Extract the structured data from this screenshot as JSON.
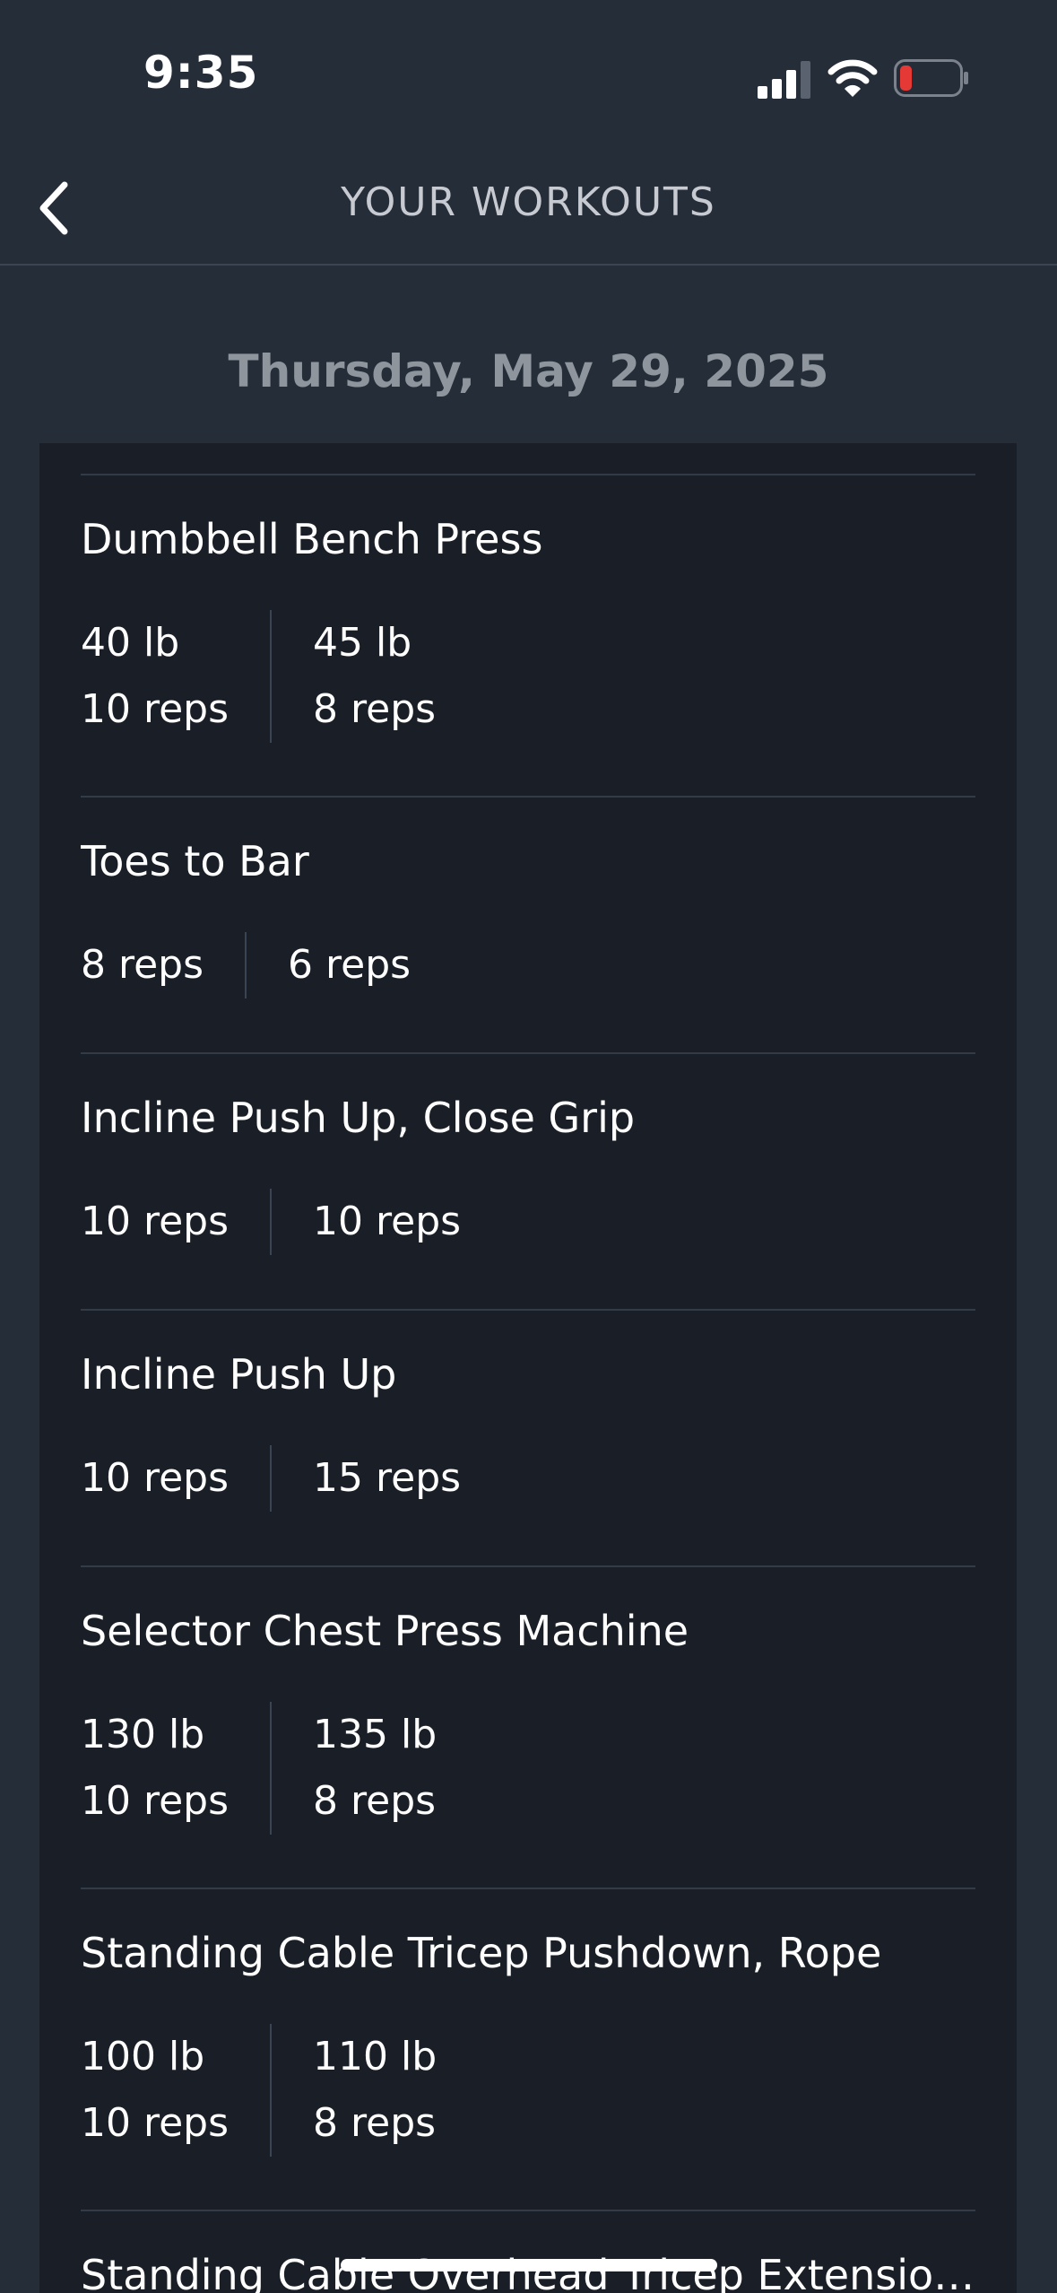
{
  "status_bar": {
    "time": "9:35",
    "icons": [
      "cellular-signal-icon",
      "wifi-icon",
      "battery-low-icon"
    ],
    "battery_color": "#e53935"
  },
  "nav": {
    "title": "YOUR WORKOUTS",
    "back_icon": "chevron-left-icon"
  },
  "date": "Thursday, May 29, 2025",
  "colors": {
    "background": "#252d39",
    "card": "#1a1f27",
    "divider": "#333b47",
    "title": "#c7cbd1",
    "date": "#8f959d"
  },
  "exercises": [
    {
      "name": "Dumbbell Bench Press",
      "sets": [
        {
          "weight": "40 lb",
          "reps": "10 reps"
        },
        {
          "weight": "45 lb",
          "reps": "8 reps"
        }
      ]
    },
    {
      "name": "Toes to Bar",
      "sets": [
        {
          "reps": "8 reps"
        },
        {
          "reps": "6 reps"
        }
      ]
    },
    {
      "name": "Incline Push Up, Close Grip",
      "sets": [
        {
          "reps": "10 reps"
        },
        {
          "reps": "10 reps"
        }
      ]
    },
    {
      "name": "Incline Push Up",
      "sets": [
        {
          "reps": "10 reps"
        },
        {
          "reps": "15 reps"
        }
      ]
    },
    {
      "name": "Selector Chest Press Machine",
      "sets": [
        {
          "weight": "130 lb",
          "reps": "10 reps"
        },
        {
          "weight": "135 lb",
          "reps": "8 reps"
        }
      ]
    },
    {
      "name": "Standing Cable Tricep Pushdown, Rope",
      "sets": [
        {
          "weight": "100 lb",
          "reps": "10 reps"
        },
        {
          "weight": "110 lb",
          "reps": "8 reps"
        }
      ]
    },
    {
      "name": "Standing Cable Overhead Tricep Extensio…",
      "sets": []
    }
  ]
}
